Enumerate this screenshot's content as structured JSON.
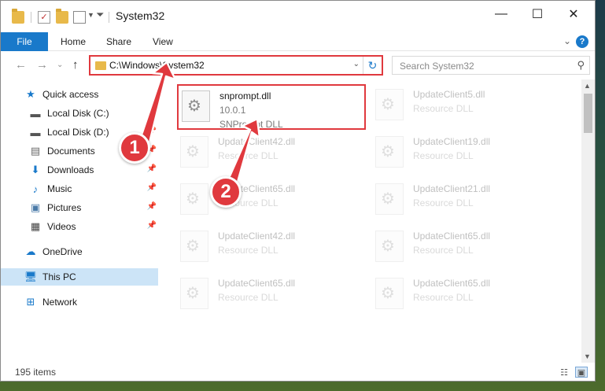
{
  "window": {
    "title": "System32",
    "minimize": "—",
    "maximize": "☐",
    "close": "✕"
  },
  "ribbon": {
    "file": "File",
    "tabs": [
      "Home",
      "Share",
      "View"
    ],
    "help": "?"
  },
  "address": {
    "path": "C:\\Windows\\System32",
    "search_placeholder": "Search System32"
  },
  "nav": {
    "items": [
      {
        "label": "Quick access",
        "icon": "star-icon"
      },
      {
        "label": "Local Disk (C:)",
        "icon": "drive-icon"
      },
      {
        "label": "Local Disk (D:)",
        "icon": "drive-icon"
      },
      {
        "label": "Documents",
        "icon": "documents-icon"
      },
      {
        "label": "Downloads",
        "icon": "download-icon"
      },
      {
        "label": "Music",
        "icon": "music-icon"
      },
      {
        "label": "Pictures",
        "icon": "pictures-icon"
      },
      {
        "label": "Videos",
        "icon": "videos-icon"
      },
      {
        "label": "OneDrive",
        "icon": "cloud-icon"
      },
      {
        "label": "This PC",
        "icon": "computer-icon"
      },
      {
        "label": "Network",
        "icon": "network-icon"
      }
    ]
  },
  "files": [
    {
      "name": "snprompt.dll",
      "line1": "10.0.1",
      "line2": "SNPrompt DLL"
    },
    {
      "name": "UpdateClient5.dll",
      "line1": "Resource DLL",
      "line2": ""
    },
    {
      "name": "UpdateClient42.dll",
      "line1": "Resource DLL",
      "line2": ""
    },
    {
      "name": "UpdateClient19.dll",
      "line1": "Resource DLL",
      "line2": ""
    },
    {
      "name": "UpdateClient65.dll",
      "line1": "Resource DLL",
      "line2": ""
    },
    {
      "name": "UpdateClient21.dll",
      "line1": "Resource DLL",
      "line2": ""
    },
    {
      "name": "UpdateClient42.dll",
      "line1": "Resource DLL",
      "line2": ""
    },
    {
      "name": "UpdateClient65.dll",
      "line1": "Resource DLL",
      "line2": ""
    },
    {
      "name": "UpdateClient65.dll",
      "line1": "Resource DLL",
      "line2": ""
    },
    {
      "name": "UpdateClient65.dll",
      "line1": "Resource DLL",
      "line2": ""
    }
  ],
  "status": {
    "count": "195 items"
  },
  "callouts": {
    "step1": "1",
    "step2": "2"
  },
  "colors": {
    "accent": "#1979ca",
    "highlight": "#e0393e",
    "selected": "#cce4f7"
  }
}
